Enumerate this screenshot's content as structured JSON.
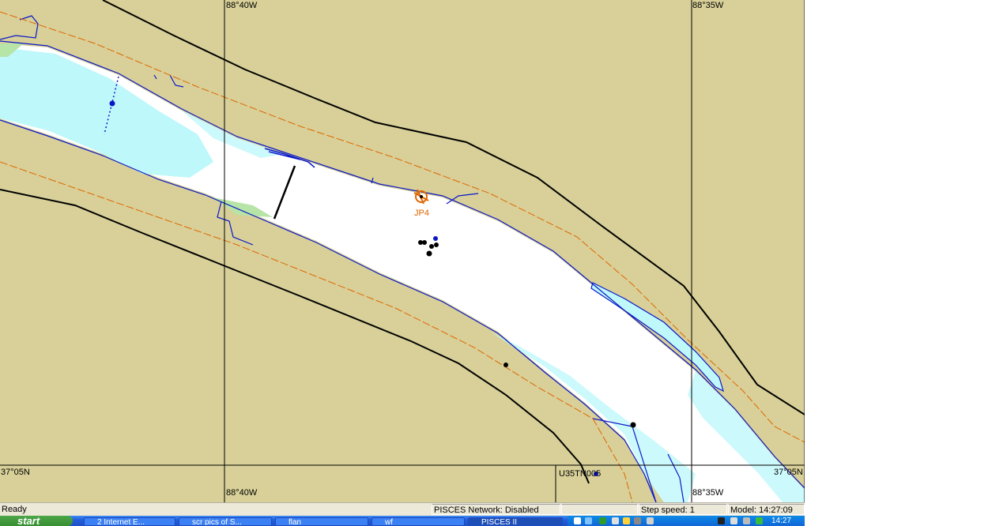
{
  "map": {
    "grid_labels": {
      "lon_top_left": "88°40W",
      "lon_top_right": "88°35W",
      "lon_bottom_left": "88°40W",
      "lon_bottom_right": "88°35W",
      "lat_left": "37°05N",
      "lat_right": "37°05N"
    },
    "vessel_label": "JP4",
    "inset_label": "U35TN005",
    "colors": {
      "land": "#d8d098",
      "water": "#ffffff",
      "shallow": "#bff8fa",
      "shoreline": "#0a17c9",
      "channel": "#e06600",
      "boundary": "#000000",
      "vegetation": "#b7e4a7"
    }
  },
  "status": {
    "ready": "Ready",
    "network": "PISCES Network: Disabled",
    "step_speed": "Step speed: 1",
    "model_time": "Model: 14:27:09"
  },
  "taskbar": {
    "start_label": "start",
    "tasks": [
      "2 Internet E...",
      "scr pics of S...",
      "flan",
      "wf",
      "PISCES II"
    ],
    "clock": "14:27"
  }
}
